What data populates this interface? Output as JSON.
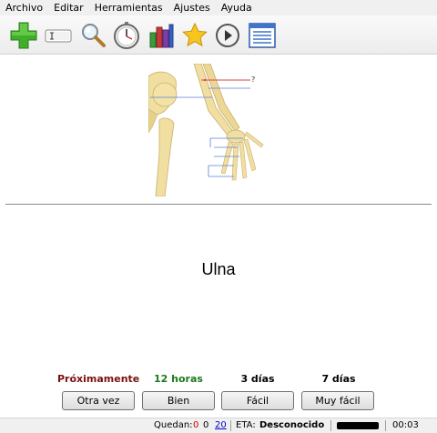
{
  "menu": {
    "items": [
      "Archivo",
      "Editar",
      "Herramientas",
      "Ajustes",
      "Ayuda"
    ]
  },
  "toolbar": {
    "buttons": [
      "add-icon",
      "edit-card-icon",
      "search-icon",
      "clock-icon",
      "statistics-icon",
      "star-icon",
      "play-icon",
      "list-icon"
    ]
  },
  "question": {
    "marker": "?"
  },
  "answer": {
    "text": "Ulna"
  },
  "intervals": {
    "again": "Próximamente",
    "good": "12 horas",
    "easy": "3 días",
    "very_easy": "7 días"
  },
  "interval_colors": {
    "again": "#7a1010",
    "good": "#1a7a1a",
    "easy": "#000000",
    "very_easy": "#000000"
  },
  "buttons": {
    "again": "Otra vez",
    "good": "Bien",
    "easy": "Fácil",
    "very_easy": "Muy fácil"
  },
  "status": {
    "remaining_label": "Quedan:",
    "remaining_red": "0",
    "remaining_black": "0",
    "remaining_blue": "20",
    "eta_label": "ETA:",
    "eta_value": "Desconocido",
    "time": "00:03"
  }
}
